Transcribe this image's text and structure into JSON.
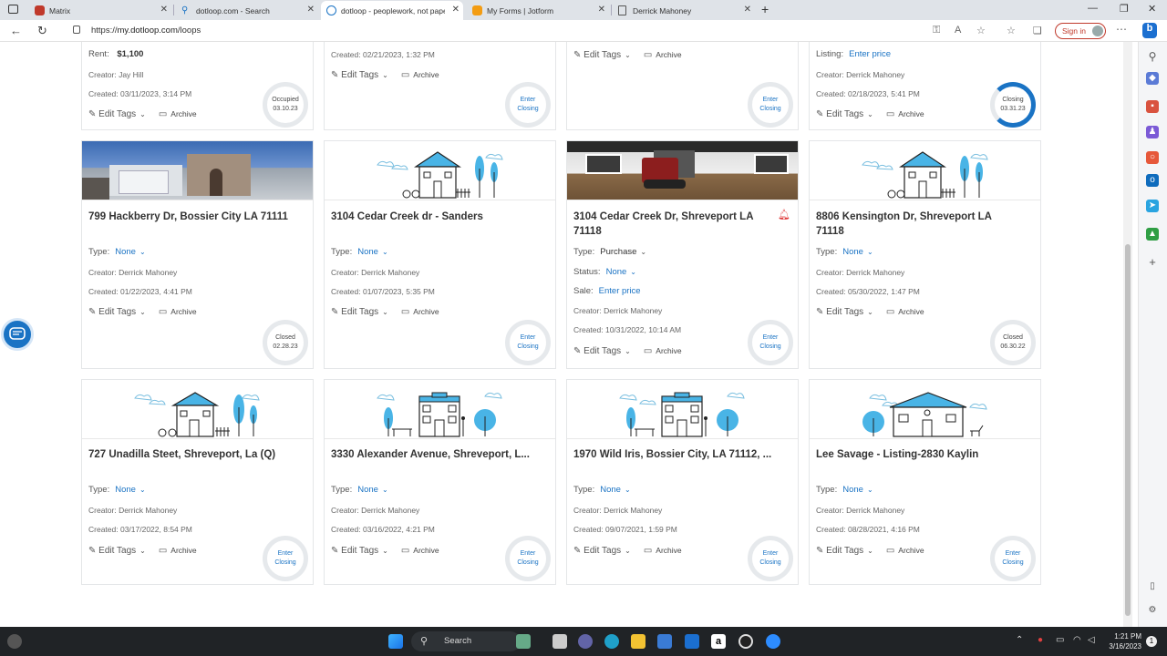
{
  "browser": {
    "tabs": [
      {
        "title": "Matrix",
        "active": false
      },
      {
        "title": "dotloop.com - Search",
        "active": false
      },
      {
        "title": "dotloop - peoplework, not pape",
        "active": true
      },
      {
        "title": "My Forms | Jotform",
        "active": false
      },
      {
        "title": "Derrick Mahoney",
        "active": false
      }
    ],
    "url_prefix": "https://",
    "url_host": "my.dotloop.com",
    "url_path": "/loops",
    "signin_label": "Sign in"
  },
  "labels": {
    "type": "Type:",
    "status": "Status:",
    "sale": "Sale:",
    "listing": "Listing:",
    "rent": "Rent:",
    "edit_tags": "Edit Tags",
    "archive": "Archive",
    "none": "None"
  },
  "top_partial": [
    {
      "line1_label": "Rent:",
      "line1_value": "$1,100",
      "creator": "Creator: Jay Hill",
      "created": "Created: 03/11/2023, 3:14 PM",
      "ring_line1": "Occupied",
      "ring_line2": "03.10.23"
    },
    {
      "line1_label": "",
      "line1_value": "",
      "creator": "",
      "created": "Created: 02/21/2023, 1:32 PM",
      "ring_line1": "Enter",
      "ring_line2": "Closing"
    },
    {
      "line1_label": "",
      "line1_value": "",
      "creator": "",
      "created": "",
      "ring_line1": "Enter",
      "ring_line2": "Closing"
    },
    {
      "line1_label": "Listing:",
      "line1_value": "Enter price",
      "creator": "Creator: Derrick Mahoney",
      "created": "Created: 02/18/2023, 5:41 PM",
      "ring_line1": "Closing",
      "ring_line2": "03.31.23"
    }
  ],
  "row2": [
    {
      "title": "799 Hackberry Dr, Bossier City LA 71111",
      "type_value": "None",
      "creator": "Creator: Derrick Mahoney",
      "created": "Created: 01/22/2023, 4:41 PM",
      "ring_line1": "Closed",
      "ring_line2": "02.28.23"
    },
    {
      "title": "3104 Cedar Creek dr - Sanders",
      "type_value": "None",
      "creator": "Creator: Derrick Mahoney",
      "created": "Created: 01/07/2023, 5:35 PM",
      "ring_line1": "Enter",
      "ring_line2": "Closing"
    },
    {
      "title": "3104 Cedar Creek Dr, Shreveport LA 71118",
      "type_value": "Purchase",
      "status_value": "None",
      "sale_value": "Enter price",
      "creator": "Creator: Derrick Mahoney",
      "created": "Created: 10/31/2022, 10:14 AM",
      "ring_line1": "Enter",
      "ring_line2": "Closing"
    },
    {
      "title": "8806 Kensington Dr, Shreveport LA 71118",
      "type_value": "None",
      "creator": "Creator: Derrick Mahoney",
      "created": "Created: 05/30/2022, 1:47 PM",
      "ring_line1": "Closed",
      "ring_line2": "06.30.22"
    }
  ],
  "row3": [
    {
      "title": "727 Unadilla Steet, Shreveport, La (Q)",
      "type_value": "None",
      "creator": "Creator: Derrick Mahoney",
      "created": "Created: 03/17/2022, 8:54 PM",
      "ring_line1": "Enter",
      "ring_line2": "Closing"
    },
    {
      "title": "3330 Alexander Avenue, Shreveport, L...",
      "type_value": "None",
      "creator": "Creator: Derrick Mahoney",
      "created": "Created: 03/16/2022, 4:21 PM",
      "ring_line1": "Enter",
      "ring_line2": "Closing"
    },
    {
      "title": "1970 Wild Iris, Bossier City, LA 71112, ...",
      "type_value": "None",
      "creator": "Creator: Derrick Mahoney",
      "created": "Created: 09/07/2021, 1:59 PM",
      "ring_line1": "Enter",
      "ring_line2": "Closing"
    },
    {
      "title": "Lee Savage - Listing-2830 Kaylin",
      "type_value": "None",
      "creator": "Creator: Derrick Mahoney",
      "created": "Created: 08/28/2021, 4:16 PM",
      "ring_line1": "Enter",
      "ring_line2": "Closing"
    }
  ],
  "taskbar": {
    "search_label": "Search",
    "time": "1:21 PM",
    "date": "3/16/2023"
  },
  "colors": {
    "accent": "#1a73c4",
    "bell": "#e03a3a",
    "card_border": "#e4e6e8"
  }
}
